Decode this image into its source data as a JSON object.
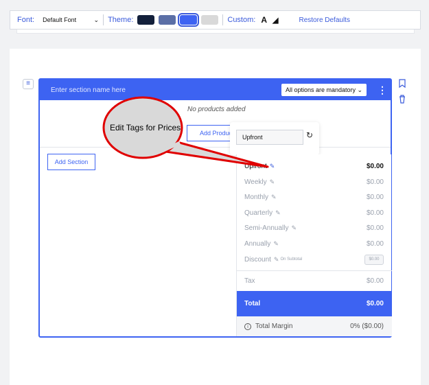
{
  "toolbar": {
    "font_label": "Font:",
    "font_value": "Default Font",
    "theme_label": "Theme:",
    "custom_label": "Custom:",
    "restore_label": "Restore Defaults",
    "theme_colors": [
      "#13203b",
      "#5b6fa6",
      "#3d63f2",
      "#d9d9d9"
    ],
    "selected_theme_index": 2
  },
  "section": {
    "name_placeholder": "Enter section name here",
    "mandatory_select": "All options are mandatory",
    "no_products": "No products added",
    "add_products": "Add Products",
    "add_section": "Add Section"
  },
  "popup": {
    "input_value": "Upfront"
  },
  "prices": {
    "rows": [
      {
        "label": "Upfront",
        "amount": "$0.00"
      },
      {
        "label": "Weekly",
        "amount": "$0.00"
      },
      {
        "label": "Monthly",
        "amount": "$0.00"
      },
      {
        "label": "Quarterly",
        "amount": "$0.00"
      },
      {
        "label": "Semi-Annually",
        "amount": "$0.00"
      },
      {
        "label": "Annually",
        "amount": "$0.00"
      }
    ],
    "discount_label": "Discount",
    "discount_note": "On Subtotal",
    "discount_value": "$0.00",
    "tax_label": "Tax",
    "tax_amount": "$0.00",
    "total_label": "Total",
    "total_amount": "$0.00",
    "margin_label": "Total Margin",
    "margin_value": "0% ($0.00)"
  },
  "callout": {
    "text": "Edit Tags for Prices"
  },
  "colors": {
    "accent": "#3d63f2",
    "callout_border": "#e00000",
    "callout_fill": "#d9d9d9"
  }
}
